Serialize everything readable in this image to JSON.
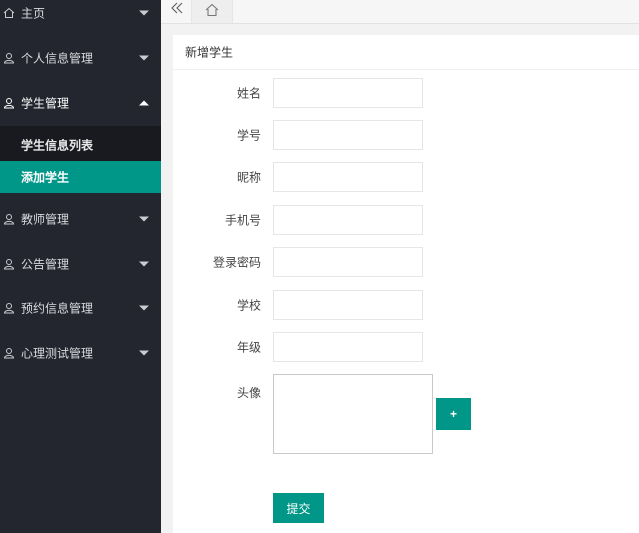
{
  "sidebar": {
    "items": [
      {
        "label": "主页",
        "icon": "home-icon"
      },
      {
        "label": "个人信息管理",
        "icon": "user-icon"
      },
      {
        "label": "学生管理",
        "icon": "user-icon",
        "expanded": true,
        "children": [
          {
            "label": "学生信息列表"
          },
          {
            "label": "添加学生",
            "active": true
          }
        ]
      },
      {
        "label": "教师管理",
        "icon": "user-icon"
      },
      {
        "label": "公告管理",
        "icon": "user-icon"
      },
      {
        "label": "预约信息管理",
        "icon": "user-icon"
      },
      {
        "label": "心理测试管理",
        "icon": "user-icon"
      }
    ]
  },
  "topbar": {
    "back_icon": "double-chevron-left-icon",
    "home_tab_icon": "home-icon"
  },
  "form": {
    "title": "新增学生",
    "fields": [
      {
        "label": "姓名",
        "value": "",
        "placeholder": ""
      },
      {
        "label": "学号",
        "value": "",
        "placeholder": ""
      },
      {
        "label": "昵称",
        "value": "",
        "placeholder": ""
      },
      {
        "label": "手机号",
        "value": "",
        "placeholder": ""
      },
      {
        "label": "登录密码",
        "value": "",
        "placeholder": ""
      },
      {
        "label": "学校",
        "value": "",
        "placeholder": ""
      },
      {
        "label": "年级",
        "value": "",
        "placeholder": ""
      }
    ],
    "avatar_label": "头像",
    "upload_button": "+",
    "submit_button": "提交"
  },
  "colors": {
    "accent": "#009688",
    "sidebar_bg": "#23262e",
    "submenu_bg": "#191a1f"
  }
}
